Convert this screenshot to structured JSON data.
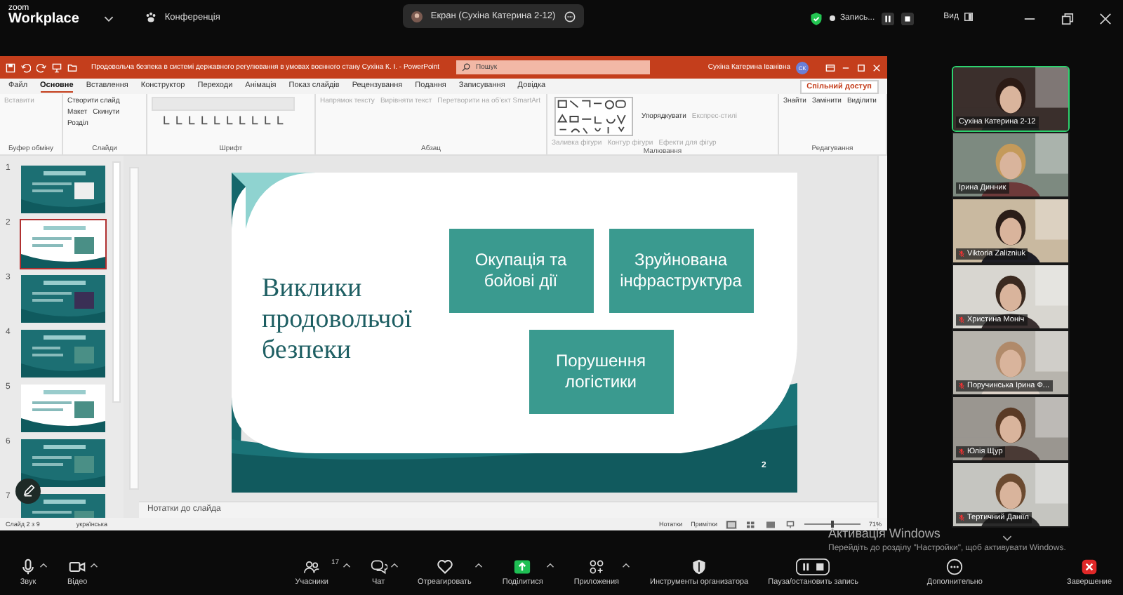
{
  "zoom_bar": {
    "logo_top": "zoom",
    "logo_bottom": "Workplace",
    "meeting_button": "Конференція",
    "share_pill": "Екран (Сухіна Катерина 2-12)",
    "recording": "Запись...",
    "view": "Вид"
  },
  "powerpoint": {
    "title": "Продовольча безпека в системі державного регулювання в умовах воєнного стану Сухіна К. І.  -  PowerPoint",
    "search": {
      "placeholder": "Пошук"
    },
    "user": "Сухіна Катерина Іванівна",
    "avatar": "СК",
    "tabs": [
      {
        "label": "Файл",
        "selected": false
      },
      {
        "label": "Основне",
        "selected": true
      },
      {
        "label": "Вставлення",
        "selected": false
      },
      {
        "label": "Конструктор",
        "selected": false
      },
      {
        "label": "Переходи",
        "selected": false
      },
      {
        "label": "Анімація",
        "selected": false
      },
      {
        "label": "Показ слайдів",
        "selected": false
      },
      {
        "label": "Рецензування",
        "selected": false
      },
      {
        "label": "Подання",
        "selected": false
      },
      {
        "label": "Записування",
        "selected": false
      },
      {
        "label": "Довідка",
        "selected": false
      }
    ],
    "share_button": "Спільний доступ",
    "ribbon_groups": [
      {
        "name": "Буфер обміну",
        "buttons": [
          {
            "label": "Вставити",
            "disabled": true
          }
        ]
      },
      {
        "name": "Слайди",
        "buttons": [
          {
            "label": "Створити слайд",
            "disabled": false
          },
          {
            "label": "Макет",
            "disabled": false
          },
          {
            "label": "Скинути",
            "disabled": false
          },
          {
            "label": "Розділ",
            "disabled": false
          }
        ]
      },
      {
        "name": "Шрифт"
      },
      {
        "name": "Абзац",
        "buttons": [
          {
            "label": "Напрямок тексту",
            "disabled": true
          },
          {
            "label": "Вирівняти текст",
            "disabled": true
          },
          {
            "label": "Перетворити на об’єкт SmartArt",
            "disabled": true
          }
        ]
      },
      {
        "name": "Малювання",
        "buttons": [
          {
            "label": "Упорядкувати",
            "disabled": false
          },
          {
            "label": "Експрес-стилі",
            "disabled": true
          },
          {
            "label": "Заливка фігури",
            "disabled": true
          },
          {
            "label": "Контур фігури",
            "disabled": true
          },
          {
            "label": "Ефекти для фігур",
            "disabled": true
          }
        ]
      },
      {
        "name": "Редагування",
        "buttons": [
          {
            "label": "Знайти",
            "disabled": false
          },
          {
            "label": "Замінити",
            "disabled": false
          },
          {
            "label": "Виділити",
            "disabled": false
          }
        ]
      }
    ],
    "slides": [
      {
        "number": "1",
        "selected": false
      },
      {
        "number": "2",
        "selected": true
      },
      {
        "number": "3",
        "selected": false
      },
      {
        "number": "4",
        "selected": false
      },
      {
        "number": "5",
        "selected": false
      },
      {
        "number": "6",
        "selected": false
      },
      {
        "number": "7",
        "selected": false
      }
    ],
    "slide": {
      "title": "Виклики продовольчої безпеки",
      "boxes": [
        "Окупація та бойові дії",
        "Зруйнована інфраструктура",
        "Порушення логістики"
      ],
      "page_number": "2"
    },
    "notes_placeholder": "Нотатки до слайда",
    "status": {
      "slide": "Слайд 2 з 9",
      "language": "українська",
      "notes": "Нотатки",
      "comments": "Примітки",
      "zoom": "71%",
      "level": 0.5
    }
  },
  "participants": [
    {
      "name": "Сухіна Катерина 2-12",
      "muted": false,
      "active": true
    },
    {
      "name": "Ірина  Динник",
      "muted": false,
      "active": false
    },
    {
      "name": "Viktoria Zalizniuk",
      "muted": true,
      "active": false
    },
    {
      "name": "Христина Моніч",
      "muted": true,
      "active": false
    },
    {
      "name": "Поручинська Ірина Ф...",
      "muted": true,
      "active": false
    },
    {
      "name": "Юлія Щур",
      "muted": true,
      "active": false
    },
    {
      "name": "Тертичний Даніїл",
      "muted": true,
      "active": false
    }
  ],
  "activation": {
    "title": "Активація Windows",
    "text": "Перейдіть до розділу \"Настройки\", щоб активувати Windows."
  },
  "toolbar": [
    {
      "kind": "mic",
      "label": "Звук",
      "caret": true
    },
    {
      "kind": "video",
      "label": "Відео",
      "caret": true
    },
    {
      "kind": "people",
      "label": "Учасники",
      "count": "17",
      "caret": true
    },
    {
      "kind": "chat",
      "label": "Чат",
      "caret": true
    },
    {
      "kind": "heart",
      "label": "Отреагировать",
      "caret": true
    },
    {
      "kind": "share",
      "label": "Поділитися",
      "caret": true
    },
    {
      "kind": "apps",
      "label": "Приложения",
      "caret": true
    },
    {
      "kind": "shield",
      "label": "Инструменты организатора",
      "caret": false
    },
    {
      "kind": "record",
      "label": "Пауза/остановить запись",
      "caret": false
    },
    {
      "kind": "more",
      "label": "Дополнительно",
      "caret": false
    },
    {
      "kind": "end",
      "label": "Завершение",
      "caret": false
    }
  ]
}
